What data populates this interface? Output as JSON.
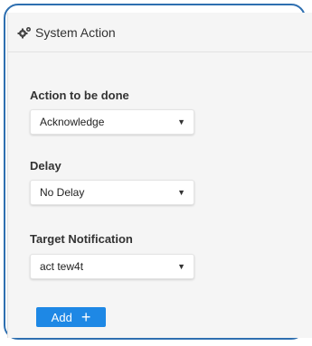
{
  "panel": {
    "title": "System Action",
    "icon": "gears-icon"
  },
  "fields": [
    {
      "label": "Action to be done",
      "value": "Acknowledge"
    },
    {
      "label": "Delay",
      "value": "No Delay"
    },
    {
      "label": "Target Notification",
      "value": "act tew4t"
    }
  ],
  "add_button": {
    "label": "Add",
    "icon": "plus-icon"
  },
  "colors": {
    "frame_border": "#2e6fb0",
    "button": "#1e88e5",
    "panel_bg": "#f5f5f5"
  }
}
